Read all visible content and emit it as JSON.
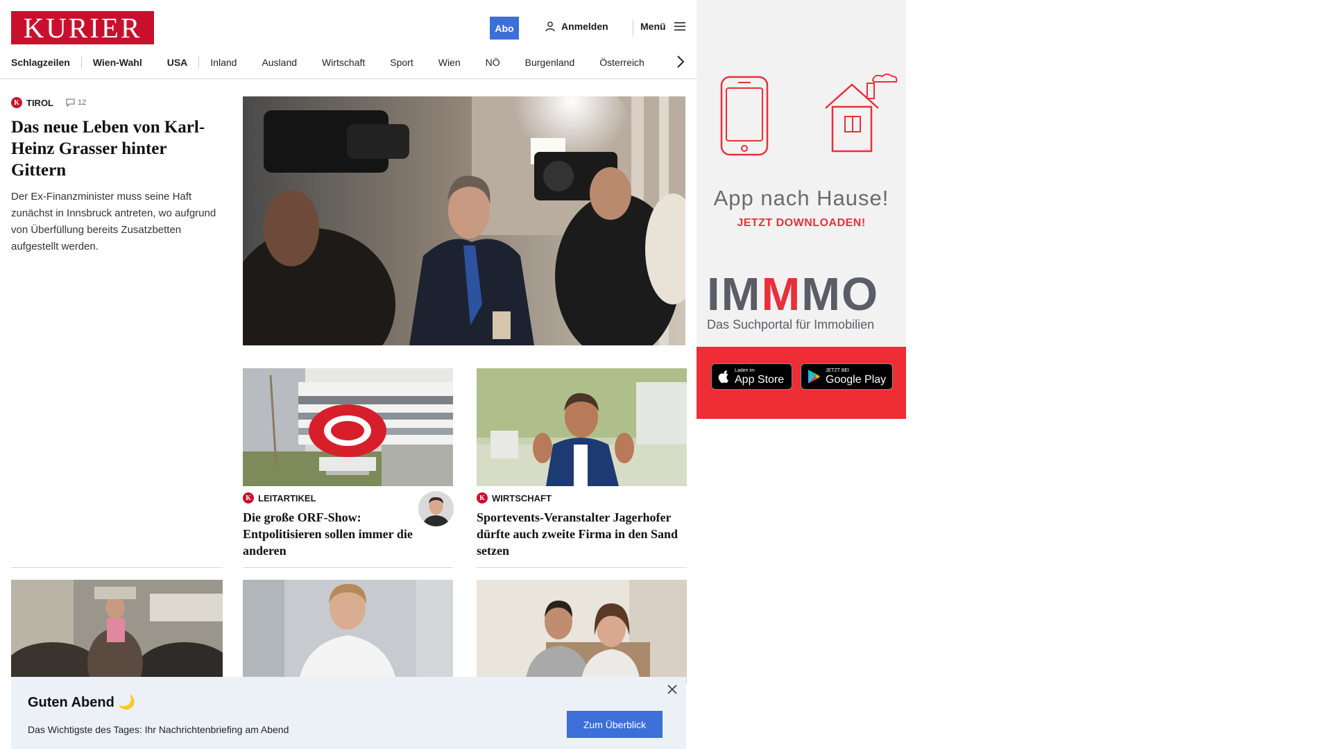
{
  "header": {
    "logo": "KURIER",
    "abo_label": "Abo",
    "login_label": "Anmelden",
    "menu_label": "Menü",
    "nav": [
      "Schlagzeilen",
      "Wien-Wahl",
      "USA",
      "Inland",
      "Ausland",
      "Wirtschaft",
      "Sport",
      "Wien",
      "NÖ",
      "Burgenland",
      "Österreich"
    ]
  },
  "lead": {
    "section": "TIROL",
    "comment_count": "12",
    "title": "Das neue Leben von Karl-Heinz Grasser hinter Gittern",
    "teaser": "Der Ex-Finanzminister muss seine Haft zunächst in Innsbruck antreten, wo aufgrund von Überfüllung bereits Zusatzbetten aufgestellt werden."
  },
  "articles": [
    {
      "section": "LEITARTIKEL",
      "title": "Die große ORF-Show: Entpolitisieren sollen immer die anderen"
    },
    {
      "section": "WIRTSCHAFT",
      "title": "Sportevents-Veranstalter Jagerhofer dürfte auch zweite Firma in den Sand setzen"
    }
  ],
  "ad": {
    "title": "App nach Hause!",
    "cta": "JETZT DOWNLOADEN!",
    "brand": "IMMMO",
    "brand_parts": [
      "IM",
      "M",
      "MO"
    ],
    "tagline": "Das Suchportal für Immobilien",
    "appstore_small": "Laden im",
    "appstore_big": "App Store",
    "googleplay_small": "JETZT BEI",
    "googleplay_big": "Google Play"
  },
  "notification": {
    "title": "Guten Abend 🌙",
    "text": "Das Wichtigste des Tages: Ihr Nachrichtenbriefing am Abend",
    "button": "Zum Überblick"
  },
  "colors": {
    "brand_red": "#c8102e",
    "accent_blue": "#3c6fd7",
    "ad_red": "#ee2e34",
    "notification_bg": "#ecf1f8"
  }
}
